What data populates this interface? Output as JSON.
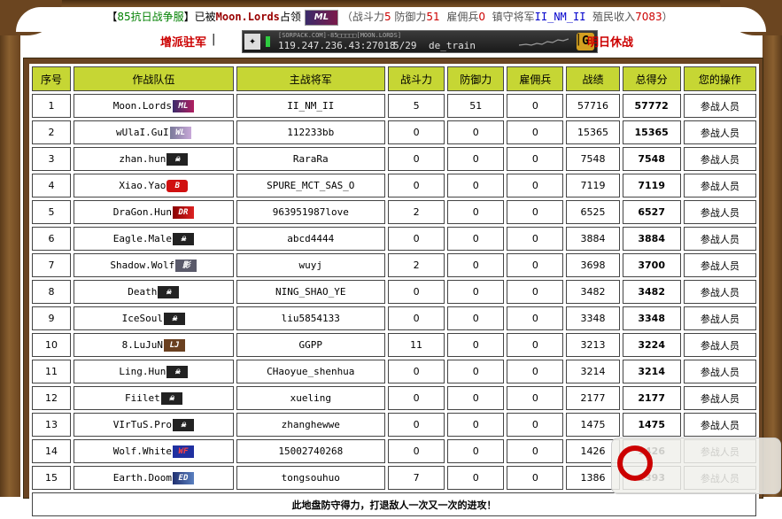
{
  "header": {
    "bracket_open": "【",
    "server_name": "85抗日战争服",
    "bracket_close": "】",
    "occupied_by": "已被",
    "occupier": "Moon.Lords",
    "occupied": "占领",
    "occupier_logo": "ML",
    "stats_open": "（战斗力",
    "combat": "5",
    "defense_label": "防御力",
    "defense": "51",
    "merc_label": "雇佣兵",
    "merc": "0",
    "general_label": "镇守将军",
    "general": "II_NM_II",
    "income_label": "殖民收入",
    "income": "7083",
    "stats_close": "）"
  },
  "subbar": {
    "left_link": "增派驻军",
    "server_small": "[SORPACK.COM]-85□□□□□[MOON.LORDS]",
    "server_ip": "119.247.236.43:27018",
    "players": "5/29",
    "map": "de_train",
    "go_icon": "G",
    "right_link": "明日休战"
  },
  "table": {
    "headers": [
      "序号",
      "作战队伍",
      "主战将军",
      "战斗力",
      "防御力",
      "雇佣兵",
      "战绩",
      "总得分",
      "您的操作"
    ],
    "rows": [
      {
        "no": "1",
        "team": "Moon.Lords",
        "logo": "ml",
        "logo_text": "ML",
        "general": "II_NM_II",
        "combat": "5",
        "defense": "51",
        "merc": "0",
        "record": "57716",
        "score": "57772",
        "action": "参战人员"
      },
      {
        "no": "2",
        "team": "wUlaI.GuI",
        "logo": "wl",
        "logo_text": "WL",
        "general": "112233bb",
        "combat": "0",
        "defense": "0",
        "merc": "0",
        "record": "15365",
        "score": "15365",
        "action": "参战人员"
      },
      {
        "no": "3",
        "team": "zhan.hun",
        "logo": "skull",
        "logo_text": "☠",
        "general": "RaraRa",
        "combat": "0",
        "defense": "0",
        "merc": "0",
        "record": "7548",
        "score": "7548",
        "action": "参战人员"
      },
      {
        "no": "4",
        "team": "Xiao.Yao",
        "logo": "b",
        "logo_text": "B",
        "general": "SPURE_MCT_SAS_O",
        "combat": "0",
        "defense": "0",
        "merc": "0",
        "record": "7119",
        "score": "7119",
        "action": "参战人员"
      },
      {
        "no": "5",
        "team": "DraGon.Hun",
        "logo": "dr",
        "logo_text": "DR",
        "general": "963951987love",
        "combat": "2",
        "defense": "0",
        "merc": "0",
        "record": "6525",
        "score": "6527",
        "action": "参战人员"
      },
      {
        "no": "6",
        "team": "Eagle.Male",
        "logo": "skull",
        "logo_text": "☠",
        "general": "abcd4444",
        "combat": "0",
        "defense": "0",
        "merc": "0",
        "record": "3884",
        "score": "3884",
        "action": "参战人员"
      },
      {
        "no": "7",
        "team": "Shadow.Wolf",
        "logo": "wolf",
        "logo_text": "影",
        "general": "wuyj",
        "combat": "2",
        "defense": "0",
        "merc": "0",
        "record": "3698",
        "score": "3700",
        "action": "参战人员"
      },
      {
        "no": "8",
        "team": "Death",
        "logo": "skull",
        "logo_text": "☠",
        "general": "NING_SHAO_YE",
        "combat": "0",
        "defense": "0",
        "merc": "0",
        "record": "3482",
        "score": "3482",
        "action": "参战人员"
      },
      {
        "no": "9",
        "team": "IceSoul",
        "logo": "skull",
        "logo_text": "☠",
        "general": "liu5854133",
        "combat": "0",
        "defense": "0",
        "merc": "0",
        "record": "3348",
        "score": "3348",
        "action": "参战人员"
      },
      {
        "no": "10",
        "team": "8.LuJuN",
        "logo": "lj",
        "logo_text": "LJ",
        "general": "GGPP",
        "combat": "11",
        "defense": "0",
        "merc": "0",
        "record": "3213",
        "score": "3224",
        "action": "参战人员"
      },
      {
        "no": "11",
        "team": "Ling.Hun",
        "logo": "skull",
        "logo_text": "☠",
        "general": "CHaoyue_shenhua",
        "combat": "0",
        "defense": "0",
        "merc": "0",
        "record": "3214",
        "score": "3214",
        "action": "参战人员"
      },
      {
        "no": "12",
        "team": "Fiilet",
        "logo": "skull",
        "logo_text": "☠",
        "general": "xueling",
        "combat": "0",
        "defense": "0",
        "merc": "0",
        "record": "2177",
        "score": "2177",
        "action": "参战人员"
      },
      {
        "no": "13",
        "team": "VIrTuS.Pro",
        "logo": "skull",
        "logo_text": "☠",
        "general": "zhanghewwe",
        "combat": "0",
        "defense": "0",
        "merc": "0",
        "record": "1475",
        "score": "1475",
        "action": "参战人员"
      },
      {
        "no": "14",
        "team": "Wolf.White",
        "logo": "wf",
        "logo_text": "WF",
        "general": "15002740268",
        "combat": "0",
        "defense": "0",
        "merc": "0",
        "record": "1426",
        "score": "1426",
        "action": "参战人员"
      },
      {
        "no": "15",
        "team": "Earth.Doom",
        "logo": "ed",
        "logo_text": "ED",
        "general": "tongsouhuo",
        "combat": "7",
        "defense": "0",
        "merc": "0",
        "record": "1386",
        "score": "1393",
        "action": "参战人员"
      }
    ],
    "footer": "此地盘防守得力，打退敌人一次又一次的进攻！"
  },
  "colors": {
    "header_bg": "#c6d634",
    "score_red": "#cc0000",
    "frame_brown": "#6a4422",
    "footer_green": "#008000"
  }
}
